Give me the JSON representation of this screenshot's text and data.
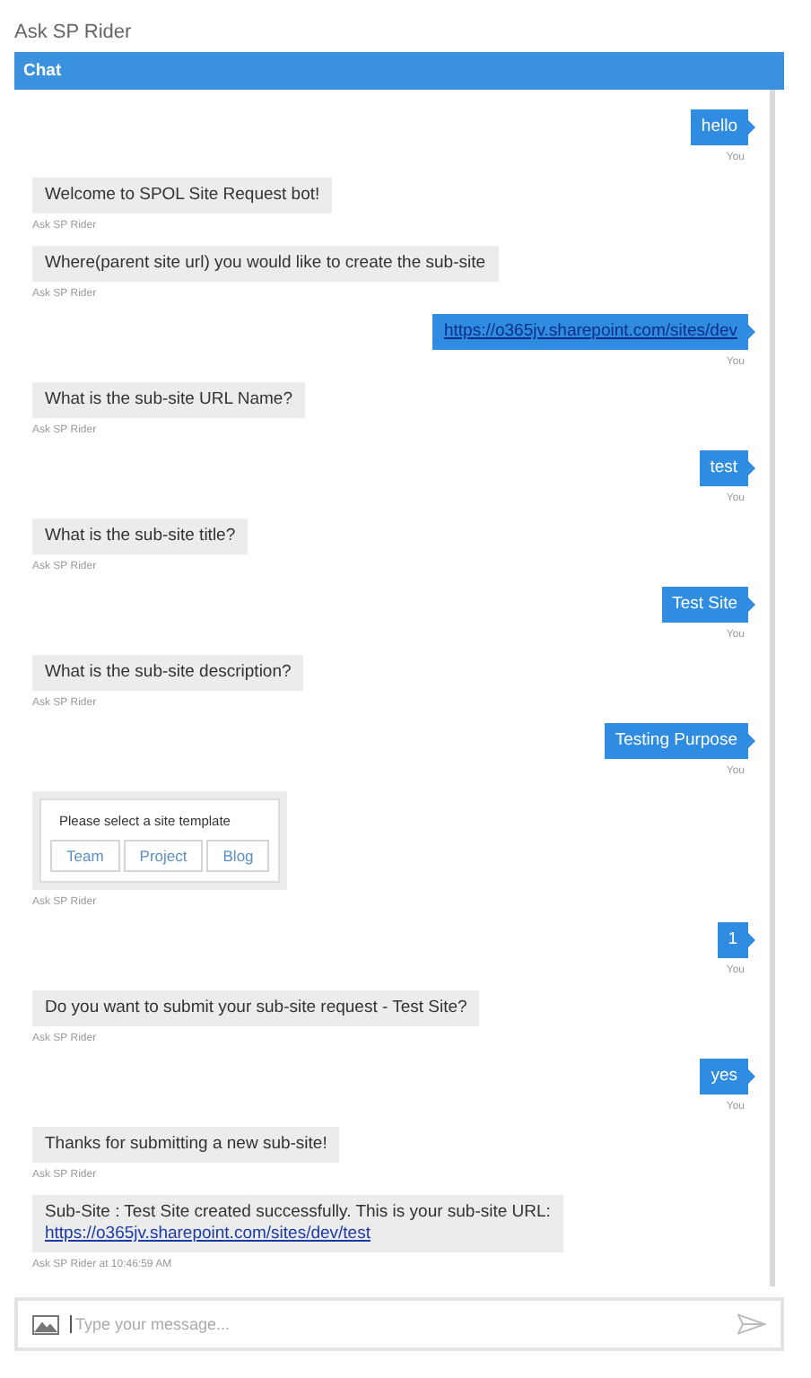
{
  "window": {
    "title": "Ask SP Rider"
  },
  "header": {
    "title": "Chat"
  },
  "messages": [
    {
      "kind": "user",
      "text": "hello",
      "sender": "You"
    },
    {
      "kind": "bot",
      "text": "Welcome to SPOL Site Request bot!",
      "sender": "Ask SP Rider"
    },
    {
      "kind": "bot",
      "text": "Where(parent site url) you would like to create the sub-site",
      "sender": "Ask SP Rider"
    },
    {
      "kind": "user",
      "link": "https://o365jv.sharepoint.com/sites/dev",
      "sender": "You"
    },
    {
      "kind": "bot",
      "text": "What is the sub-site URL Name?",
      "sender": "Ask SP Rider"
    },
    {
      "kind": "user",
      "text": "test",
      "sender": "You"
    },
    {
      "kind": "bot",
      "text": "What is the sub-site title?",
      "sender": "Ask SP Rider"
    },
    {
      "kind": "user",
      "text": "Test Site",
      "sender": "You"
    },
    {
      "kind": "bot",
      "text": "What is the sub-site description?",
      "sender": "Ask SP Rider"
    },
    {
      "kind": "user",
      "text": "Testing Purpose",
      "sender": "You"
    },
    {
      "kind": "card",
      "text": "Please select a site template",
      "buttons": [
        "Team",
        "Project",
        "Blog"
      ],
      "sender": "Ask SP Rider"
    },
    {
      "kind": "user",
      "text": "1",
      "sender": "You"
    },
    {
      "kind": "bot",
      "text": "Do you want to submit your sub-site request - Test Site?",
      "sender": "Ask SP Rider"
    },
    {
      "kind": "user",
      "text": "yes",
      "sender": "You"
    },
    {
      "kind": "bot",
      "text": "Thanks for submitting a new sub-site!",
      "sender": "Ask SP Rider"
    },
    {
      "kind": "bot",
      "text": "Sub-Site : Test Site created successfully. This is your sub-site URL:",
      "link": "https://o365jv.sharepoint.com/sites/dev/test",
      "sender": "Ask SP Rider at 10:46:59 AM"
    }
  ],
  "composer": {
    "placeholder": "Type your message..."
  }
}
